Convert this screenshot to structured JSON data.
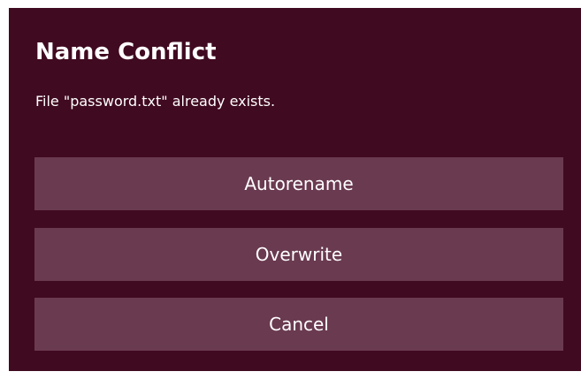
{
  "dialog": {
    "title": "Name Conflict",
    "message": "File \"password.txt\" already exists.",
    "buttons": {
      "autorename": "Autorename",
      "overwrite": "Overwrite",
      "cancel": "Cancel"
    }
  },
  "colors": {
    "background": "#400a20",
    "button": "#6a3a50",
    "text": "#ffffff"
  }
}
